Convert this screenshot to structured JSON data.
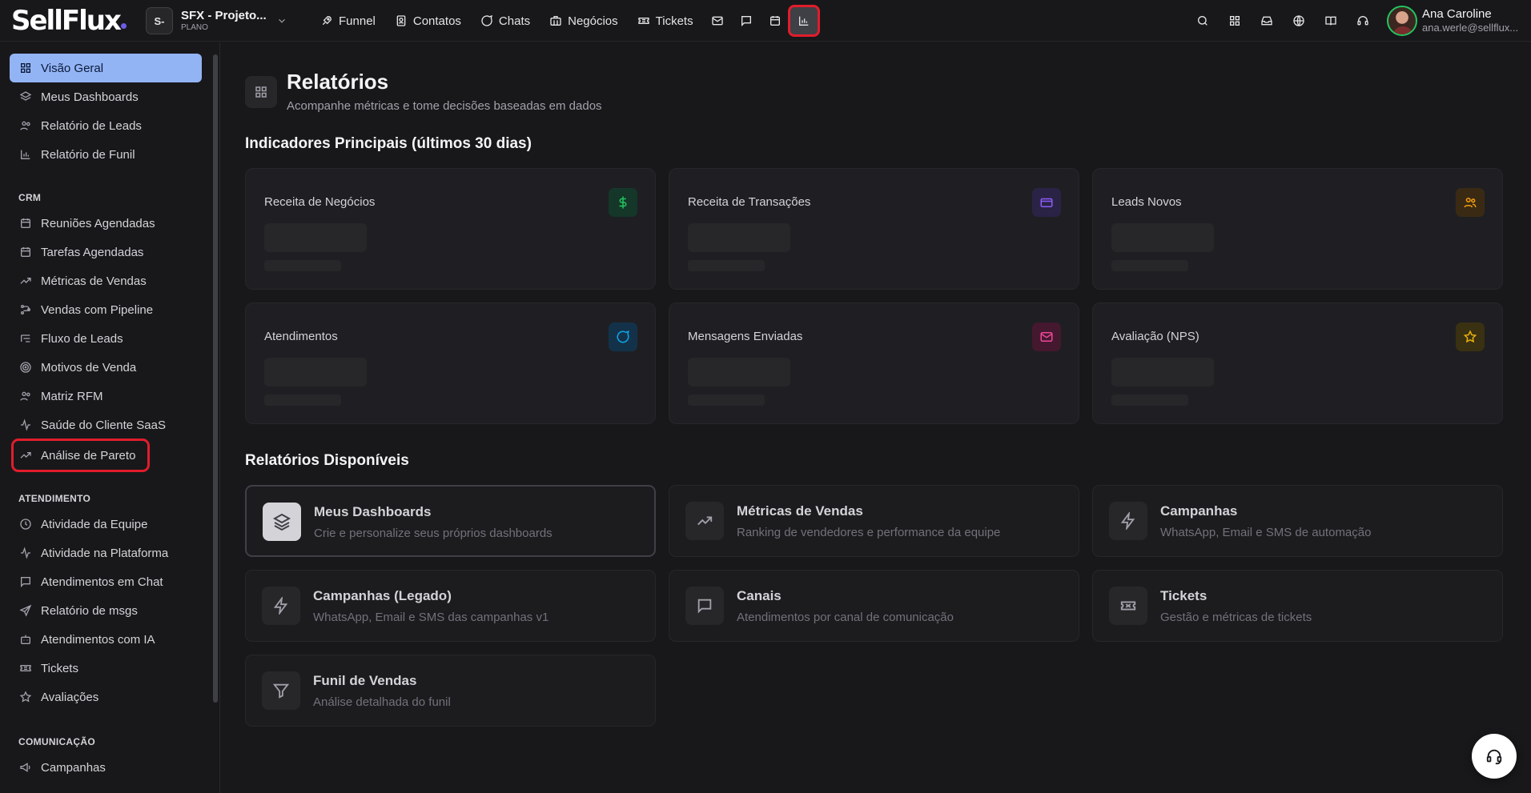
{
  "brand": {
    "logo": "SellFlux"
  },
  "project": {
    "badge": "S-",
    "name": "SFX - Projeto...",
    "plan": "PLANO"
  },
  "topnav": {
    "items": [
      {
        "label": "Funnel",
        "icon": "rocket-icon"
      },
      {
        "label": "Contatos",
        "icon": "contacts-icon"
      },
      {
        "label": "Chats",
        "icon": "chat-icon"
      },
      {
        "label": "Negócios",
        "icon": "briefcase-icon"
      },
      {
        "label": "Tickets",
        "icon": "ticket-icon"
      }
    ],
    "icon_buttons": [
      "mail-icon",
      "message-square-icon",
      "calendar-icon",
      "bar-chart-icon"
    ]
  },
  "user": {
    "name": "Ana Caroline",
    "email": "ana.werle@sellflux..."
  },
  "sidebar": {
    "main": [
      {
        "label": "Visão Geral"
      },
      {
        "label": "Meus Dashboards"
      },
      {
        "label": "Relatório de Leads"
      },
      {
        "label": "Relatório de Funil"
      }
    ],
    "crm_title": "CRM",
    "crm": [
      {
        "label": "Reuniões Agendadas"
      },
      {
        "label": "Tarefas Agendadas"
      },
      {
        "label": "Métricas de Vendas"
      },
      {
        "label": "Vendas com Pipeline"
      },
      {
        "label": "Fluxo de Leads"
      },
      {
        "label": "Motivos de Venda"
      },
      {
        "label": "Matriz RFM"
      },
      {
        "label": "Saúde do Cliente SaaS"
      },
      {
        "label": "Análise de Pareto"
      }
    ],
    "atend_title": "ATENDIMENTO",
    "atend": [
      {
        "label": "Atividade da Equipe"
      },
      {
        "label": "Atividade na Plataforma"
      },
      {
        "label": "Atendimentos em Chat"
      },
      {
        "label": "Relatório de msgs"
      },
      {
        "label": "Atendimentos com IA"
      },
      {
        "label": "Tickets"
      },
      {
        "label": "Avaliações"
      }
    ],
    "com_title": "COMUNICAÇÃO",
    "com": [
      {
        "label": "Campanhas"
      }
    ]
  },
  "page": {
    "title": "Relatórios",
    "subtitle": "Acompanhe métricas e tome decisões baseadas em dados",
    "kpi_title": "Indicadores Principais (últimos 30 dias)",
    "kpis": [
      {
        "label": "Receita de Negócios",
        "icon": "dollar-icon",
        "color": "#22c55e",
        "bg": "#14372a"
      },
      {
        "label": "Receita de Transações",
        "icon": "credit-card-icon",
        "color": "#8b5cf6",
        "bg": "#2a2346"
      },
      {
        "label": "Leads Novos",
        "icon": "users-icon",
        "color": "#f59e0b",
        "bg": "#3a2a14"
      },
      {
        "label": "Atendimentos",
        "icon": "message-circle-icon",
        "color": "#0ea5e9",
        "bg": "#13324a"
      },
      {
        "label": "Mensagens Enviadas",
        "icon": "mail-icon",
        "color": "#ec4899",
        "bg": "#44182e"
      },
      {
        "label": "Avaliação (NPS)",
        "icon": "star-icon",
        "color": "#eab308",
        "bg": "#3a3012"
      }
    ],
    "reports_title": "Relatórios Disponíveis",
    "reports": [
      {
        "title": "Meus Dashboards",
        "desc": "Crie e personalize seus próprios dashboards",
        "icon": "layers-icon"
      },
      {
        "title": "Métricas de Vendas",
        "desc": "Ranking de vendedores e performance da equipe",
        "icon": "trending-up-icon"
      },
      {
        "title": "Campanhas",
        "desc": "WhatsApp, Email e SMS de automação",
        "icon": "zap-icon"
      },
      {
        "title": "Campanhas (Legado)",
        "desc": "WhatsApp, Email e SMS das campanhas v1",
        "icon": "zap-icon"
      },
      {
        "title": "Canais",
        "desc": "Atendimentos por canal de comunicação",
        "icon": "message-square-icon"
      },
      {
        "title": "Tickets",
        "desc": "Gestão e métricas de tickets",
        "icon": "ticket-icon"
      },
      {
        "title": "Funil de Vendas",
        "desc": "Análise detalhada do funil",
        "icon": "filter-icon"
      }
    ]
  },
  "colors": {
    "accent": "#93b4f4",
    "highlight": "#e11d2b",
    "background": "#18181b"
  }
}
